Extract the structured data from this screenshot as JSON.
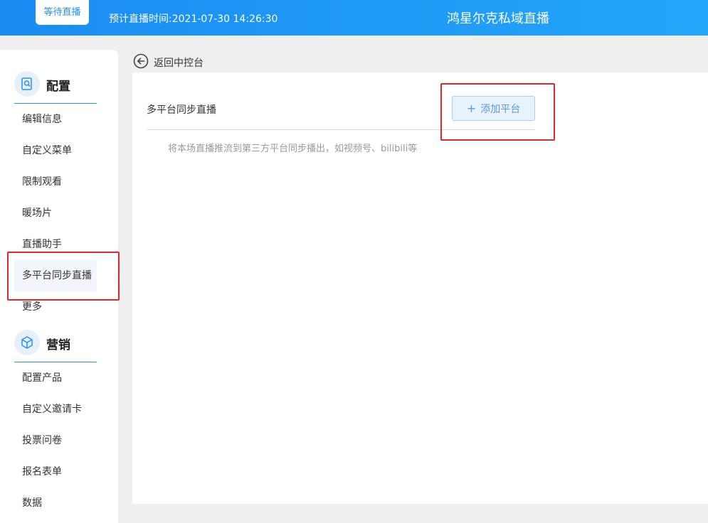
{
  "header": {
    "status_badge": "等待直播",
    "schedule": "预计直播时间:2021-07-30 14:26:30",
    "title": "鸿星尔克私域直播"
  },
  "sidebar": {
    "config_section": {
      "title": "配置",
      "icon": "config-icon",
      "items": [
        "编辑信息",
        "自定义菜单",
        "限制观看",
        "暖场片",
        "直播助手",
        "多平台同步直播",
        "更多"
      ]
    },
    "marketing_section": {
      "title": "营销",
      "icon": "cube-icon",
      "items": [
        "配置产品",
        "自定义邀请卡",
        "投票问卷",
        "报名表单",
        "数据"
      ]
    },
    "active_item": "多平台同步直播"
  },
  "main": {
    "back_label": "返回中控台",
    "panel_title": "多平台同步直播",
    "add_button": "添加平台",
    "hint": "将本场直播推流到第三方平台同步播出，如视频号、bilibili等"
  },
  "colors": {
    "header_start": "#1a8cf2",
    "header_end": "#24a6fb",
    "accent": "#2a8ff0",
    "highlight": "#e02a2a"
  }
}
